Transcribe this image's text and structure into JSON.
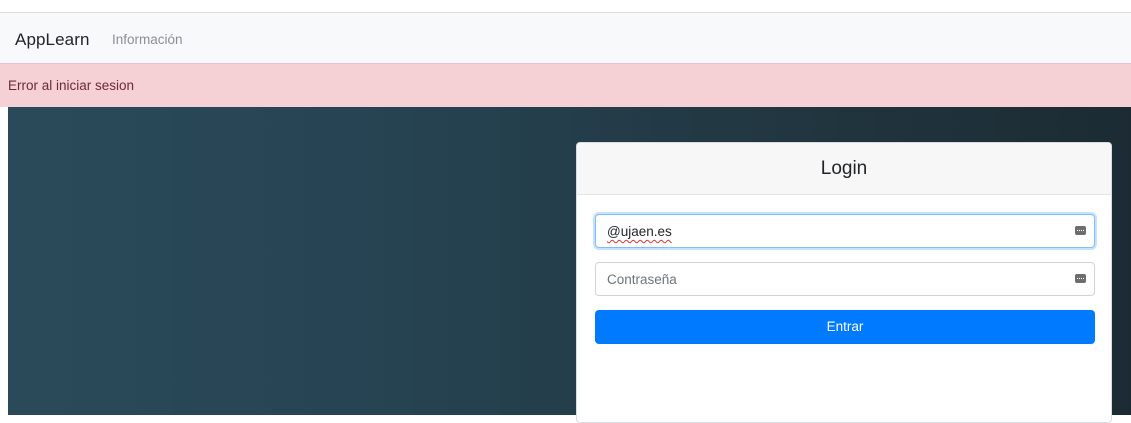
{
  "navbar": {
    "brand": "AppLearn",
    "links": [
      "Información"
    ]
  },
  "alert": {
    "message": "Error al iniciar sesion",
    "color": "#f5d1d5"
  },
  "login_card": {
    "title": "Login",
    "email_field": {
      "value": "@ujaen.es",
      "icon": "keyboard-icon"
    },
    "password_field": {
      "placeholder": "Contraseña",
      "icon": "keyboard-icon"
    },
    "submit_label": "Entrar",
    "accent_color": "#007bff"
  }
}
